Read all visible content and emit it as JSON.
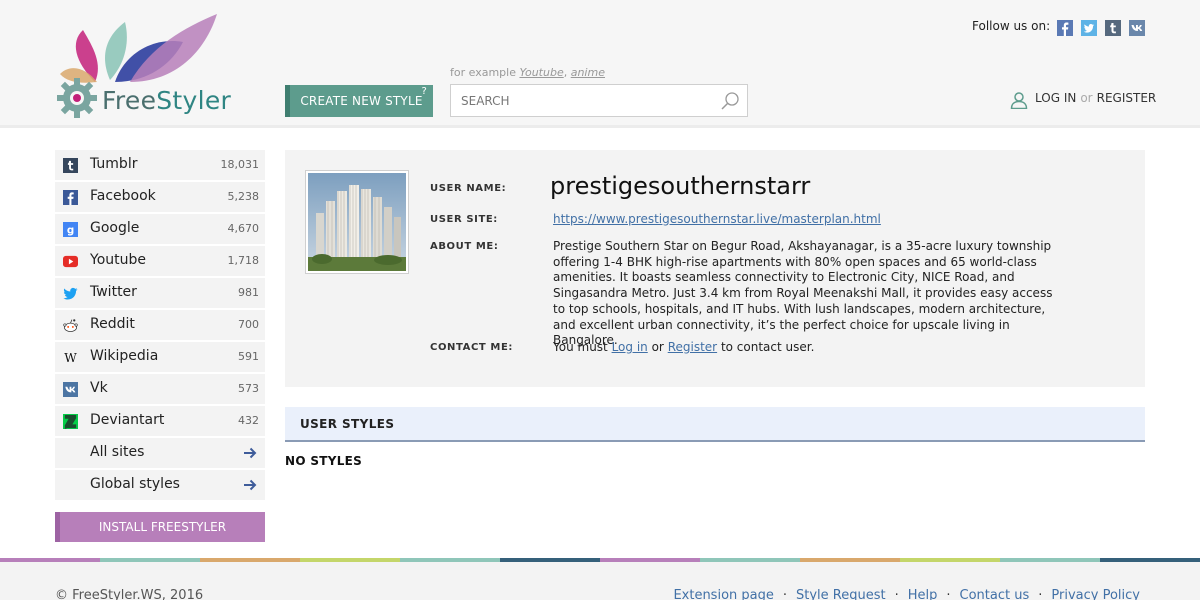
{
  "header": {
    "logo_text_a": "Free",
    "logo_text_b": "Styler",
    "create_style_label": "CREATE NEW STYLE",
    "create_style_help": "?",
    "example_prefix": "for example",
    "example_links": [
      "Youtube",
      "anime"
    ],
    "search_placeholder": "SEARCH",
    "follow_label": "Follow us on:",
    "social_icons": [
      "facebook-icon",
      "twitter-icon",
      "tumblr-icon",
      "vk-icon"
    ],
    "login_label": "LOG IN",
    "or_label": "or",
    "register_label": "REGISTER"
  },
  "sidebar": {
    "items": [
      {
        "label": "Tumblr",
        "count": "18,031",
        "icon": "tumblr-icon",
        "color": "#35465c"
      },
      {
        "label": "Facebook",
        "count": "5,238",
        "icon": "facebook-icon",
        "color": "#3b5998"
      },
      {
        "label": "Google",
        "count": "4,670",
        "icon": "google-icon",
        "color": "#4285f4"
      },
      {
        "label": "Youtube",
        "count": "1,718",
        "icon": "youtube-icon",
        "color": "#e52d27"
      },
      {
        "label": "Twitter",
        "count": "981",
        "icon": "twitter-icon",
        "color": "#1da1f2"
      },
      {
        "label": "Reddit",
        "count": "700",
        "icon": "reddit-icon",
        "color": "#ff4500"
      },
      {
        "label": "Wikipedia",
        "count": "591",
        "icon": "wikipedia-icon",
        "color": "#000000"
      },
      {
        "label": "Vk",
        "count": "573",
        "icon": "vk-icon",
        "color": "#4c75a3"
      },
      {
        "label": "Deviantart",
        "count": "432",
        "icon": "deviantart-icon",
        "color": "#05cc47"
      }
    ],
    "links": [
      {
        "label": "All sites"
      },
      {
        "label": "Global styles"
      }
    ],
    "install_label": "INSTALL FREESTYLER"
  },
  "profile": {
    "user_name_label": "USER NAME:",
    "user_name": "prestigesouthernstarr",
    "user_site_label": "USER SITE:",
    "user_site": "https://www.prestigesouthernstar.live/masterplan.html",
    "about_label": "ABOUT ME:",
    "about": "Prestige Southern Star on Begur Road, Akshayanagar, is a 35-acre luxury township offering 1-4 BHK high-rise apartments with 80% open spaces and 65 world-class amenities. It boasts seamless connectivity to Electronic City, NICE Road, and Singasandra Metro. Just 3.4 km from Royal Meenakshi Mall, it provides easy access to top schools, hospitals, and IT hubs. With lush landscapes, modern architecture, and excellent urban connectivity, it’s the perfect choice for upscale living in Bangalore.",
    "contact_label": "CONTACT ME:",
    "contact_prefix": "You must",
    "contact_login": "Log in",
    "contact_or": "or",
    "contact_register": "Register",
    "contact_suffix": "to contact user."
  },
  "styles": {
    "section_title": "USER STYLES",
    "empty_text": "NO STYLES"
  },
  "footer": {
    "copyright": "© FreeStyler.WS, 2016",
    "links": [
      "Extension page",
      "Style Request",
      "Help",
      "Contact us",
      "Privacy Policy"
    ],
    "stripe_colors": [
      "#b77fba",
      "#8fc6b9",
      "#d9a86c",
      "#c4d66a",
      "#8fc6b9",
      "#35607a",
      "#b77fba",
      "#8fc6b9",
      "#d9a86c",
      "#c4d66a",
      "#8fc6b9",
      "#35607a"
    ]
  },
  "colors": {
    "accent_teal": "#5d9c8d",
    "accent_purple": "#b77fba",
    "link_blue": "#4170a6"
  }
}
